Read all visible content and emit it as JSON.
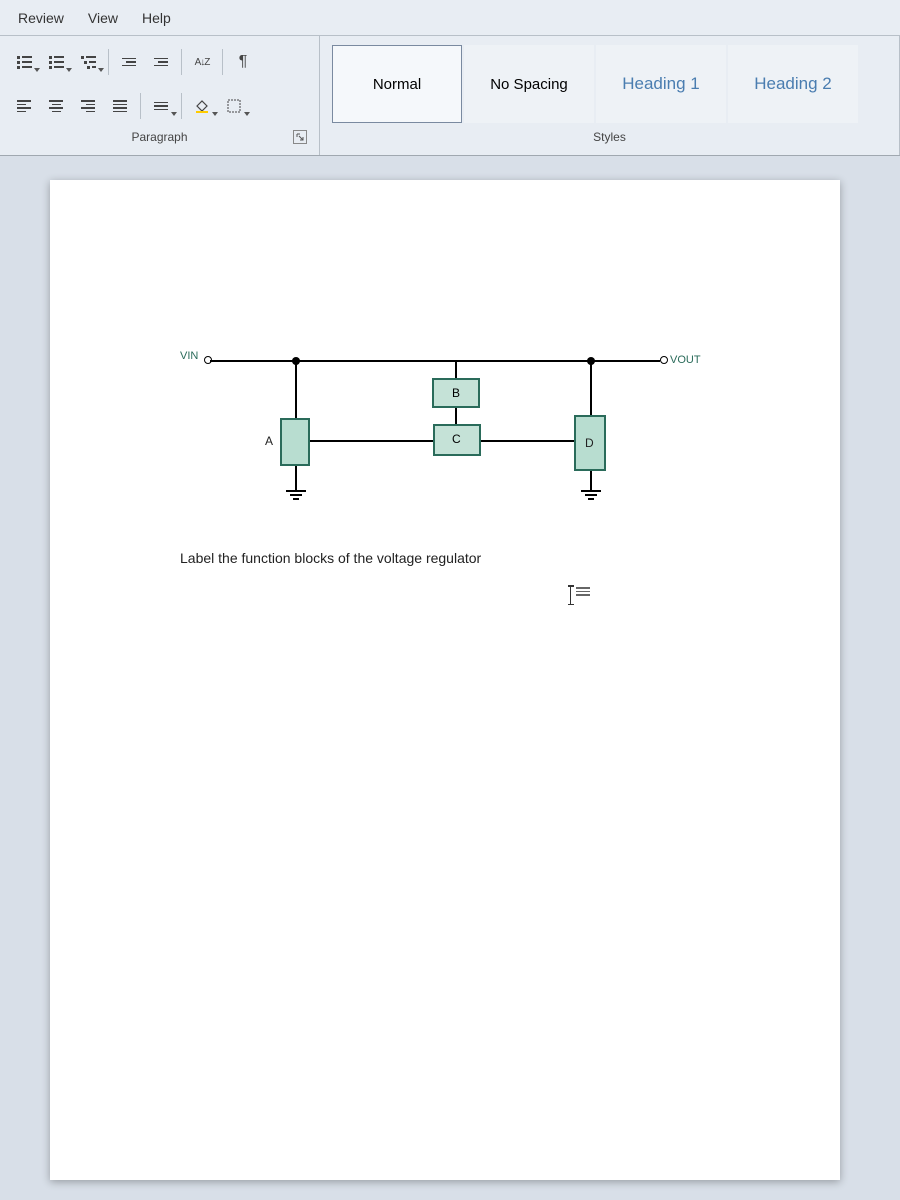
{
  "menu": {
    "review": "Review",
    "view": "View",
    "help": "Help"
  },
  "ribbon": {
    "paragraph_label": "Paragraph",
    "styles_label": "Styles",
    "sort_label": "A↓Z",
    "pilcrow": "¶"
  },
  "styles": {
    "normal": "Normal",
    "no_spacing": "No Spacing",
    "heading1": "Heading 1",
    "heading2": "Heading 2"
  },
  "document": {
    "vin": "VIN",
    "vout": "VOUT",
    "block_a": "A",
    "block_b": "B",
    "block_c": "C",
    "block_d": "D",
    "caption": "Label the function blocks of the voltage regulator"
  }
}
